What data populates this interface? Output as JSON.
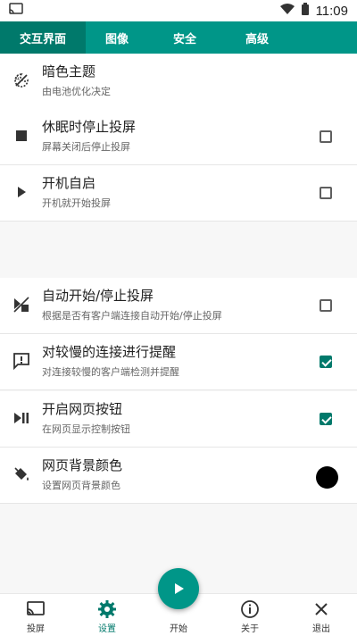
{
  "colors": {
    "accent": "#00796b",
    "accent_light": "#009688",
    "swatch": "#000000"
  },
  "statusbar": {
    "time": "11:09"
  },
  "tabs": [
    {
      "label": "交互界面",
      "active": true
    },
    {
      "label": "图像",
      "active": false
    },
    {
      "label": "安全",
      "active": false
    },
    {
      "label": "高级",
      "active": false
    }
  ],
  "settings": [
    {
      "icon": "dark-theme-icon",
      "title": "暗色主题",
      "subtitle": "由电池优化决定",
      "control": "none"
    },
    {
      "icon": "stop-icon",
      "title": "休眠时停止投屏",
      "subtitle": "屏幕关闭后停止投屏",
      "control": "checkbox",
      "checked": false
    },
    {
      "icon": "play-icon",
      "title": "开机自启",
      "subtitle": "开机就开始投屏",
      "control": "checkbox",
      "checked": false
    },
    {
      "icon": "start-stop-icon",
      "title": "自动开始/停止投屏",
      "subtitle": "根据是否有客户端连接自动开始/停止投屏",
      "control": "checkbox",
      "checked": false
    },
    {
      "icon": "alert-message-icon",
      "title": "对较慢的连接进行提醒",
      "subtitle": "对连接较慢的客户端检测并提醒",
      "control": "checkbox",
      "checked": true
    },
    {
      "icon": "play-pause-icon",
      "title": "开启网页按钮",
      "subtitle": "在网页显示控制按钮",
      "control": "checkbox",
      "checked": true
    },
    {
      "icon": "paint-bucket-icon",
      "title": "网页背景颜色",
      "subtitle": "设置网页背景颜色",
      "control": "color"
    }
  ],
  "bottom_nav": [
    {
      "icon": "cast-icon",
      "label": "投屏",
      "active": false
    },
    {
      "icon": "settings-gear-icon",
      "label": "设置",
      "active": true
    },
    {
      "icon": "play-icon",
      "label": "开始",
      "active": false
    },
    {
      "icon": "info-icon",
      "label": "关于",
      "active": false
    },
    {
      "icon": "close-icon",
      "label": "退出",
      "active": false
    }
  ]
}
